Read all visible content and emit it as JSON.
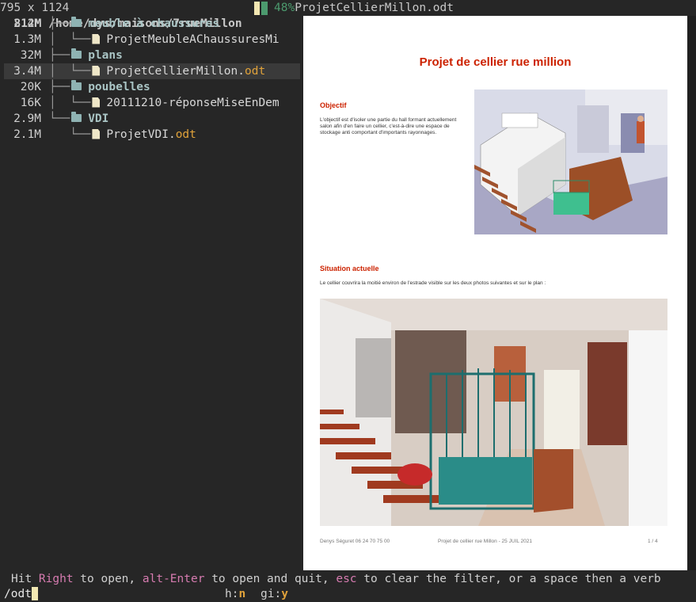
{
  "header": {
    "size": "812M",
    "path": "/home/dys/maisons/7rueMillon",
    "percent": "48%",
    "preview_file": "ProjetCellierMillon.odt",
    "dimensions": "795 x 1124"
  },
  "tree": [
    {
      "size": "2.4M",
      "branch": "├──",
      "type": "dir",
      "name": "meuble à chaussures",
      "ext": ""
    },
    {
      "size": "1.3M",
      "branch": "│  └──",
      "type": "file",
      "name": "ProjetMeubleAChaussuresMi",
      "ext": ""
    },
    {
      "size": "32M",
      "branch": "├──",
      "type": "dir",
      "name": "plans",
      "ext": ""
    },
    {
      "size": "3.4M",
      "branch": "│  └──",
      "type": "file",
      "name": "ProjetCellierMillon.",
      "ext": "odt",
      "selected": true
    },
    {
      "size": "20K",
      "branch": "├──",
      "type": "dir",
      "name": "poubelles",
      "ext": ""
    },
    {
      "size": "16K",
      "branch": "│  └──",
      "type": "file",
      "name": "20111210-réponseMiseEnDem",
      "ext": ""
    },
    {
      "size": "2.9M",
      "branch": "└──",
      "type": "dir",
      "name": "VDI",
      "ext": ""
    },
    {
      "size": "2.1M",
      "branch": "   └──",
      "type": "file",
      "name": "ProjetVDI.",
      "ext": "odt"
    }
  ],
  "document": {
    "title": "Projet de cellier rue million",
    "objectif_head": "Objectif",
    "objectif_text": "L'objectif est d'isoler une partie du hall formant actuellement salon afin d'en faire un cellier, c'est-à-dire une espace de stockage anti comportant d'importants rayonnages.",
    "situation_head": "Situation actuelle",
    "situation_text": "Le cellier couvrira la moitié environ de l'estrade visible sur les deux photos suivantes et sur le plan :",
    "footer_left": "Denys Séguret 06 24 70 75 00",
    "footer_mid": "Projet de cellier rue Millon - 25 JUIL 2021",
    "footer_right": "1 / 4"
  },
  "status": {
    "hit": "Hit ",
    "right_key": "Right",
    "to_open": " to open, ",
    "alt_key": "alt-Enter",
    "open_quit": " to open and quit, ",
    "esc_key": "esc",
    "clear": " to clear the filter, or a space then a verb"
  },
  "input": {
    "value": "/odt",
    "hint1_label": "h:",
    "hint1_val": "n",
    "hint2_label": "gi:",
    "hint2_val": "y"
  }
}
